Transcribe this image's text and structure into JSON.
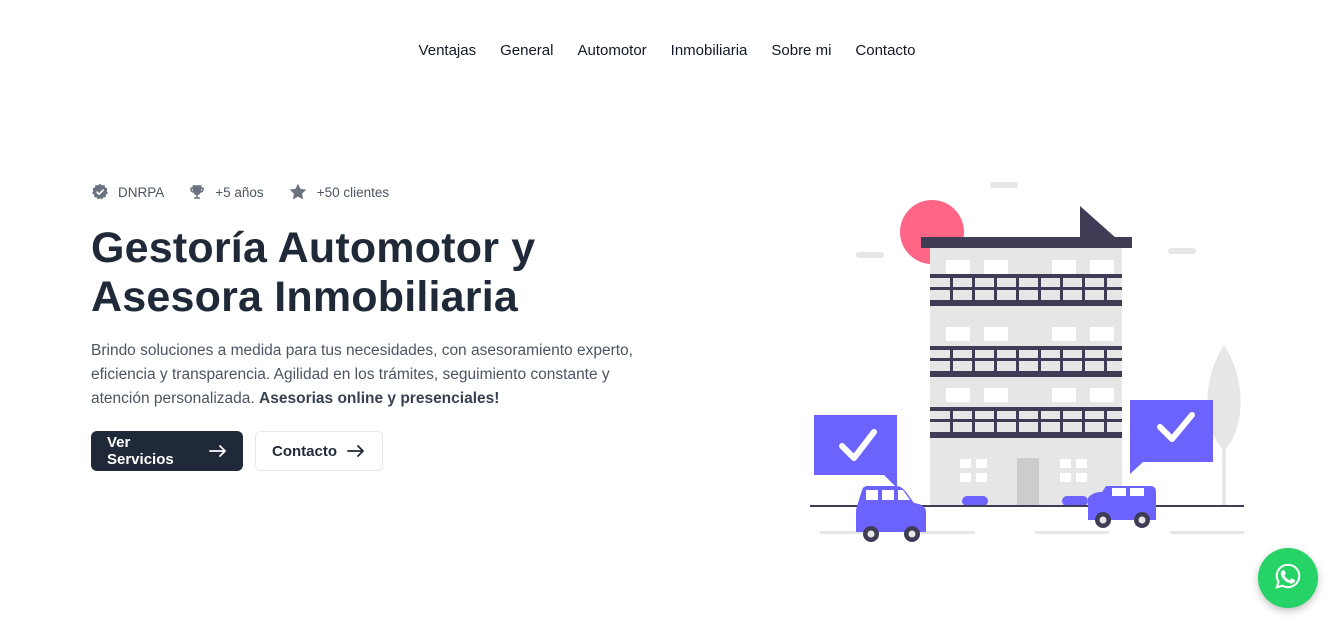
{
  "nav": {
    "items": [
      {
        "label": "Ventajas"
      },
      {
        "label": "General"
      },
      {
        "label": "Automotor"
      },
      {
        "label": "Inmobiliaria"
      },
      {
        "label": "Sobre mi"
      },
      {
        "label": "Contacto"
      }
    ]
  },
  "hero": {
    "badges": [
      {
        "icon": "verified-badge-icon",
        "label": "DNRPA"
      },
      {
        "icon": "trophy-icon",
        "label": "+5 años"
      },
      {
        "icon": "star-icon",
        "label": "+50 clientes"
      }
    ],
    "title_line1": "Gestoría Automotor y",
    "title_line2": "Asesora Inmobiliaria",
    "description": "Brindo soluciones a medida para tus necesidades, con asesoramiento experto, eficiencia y transparencia. Agilidad en los trámites, seguimiento constante y atención personalizada.",
    "description_strong": "Asesorias online y presenciales!",
    "primary_button": "Ver Servicios",
    "secondary_button": "Contacto"
  },
  "illustration": {
    "icon": "building-cars-illustration",
    "colors": {
      "accent": "#6c63ff",
      "sun": "#ff6584",
      "dark": "#3f3d56",
      "building": "#e6e6e6"
    }
  },
  "whatsapp": {
    "icon": "whatsapp-icon",
    "color": "#25d366"
  },
  "colors": {
    "primary_button": "#1f2937",
    "text": "#1f2937",
    "muted": "#4b5563"
  }
}
